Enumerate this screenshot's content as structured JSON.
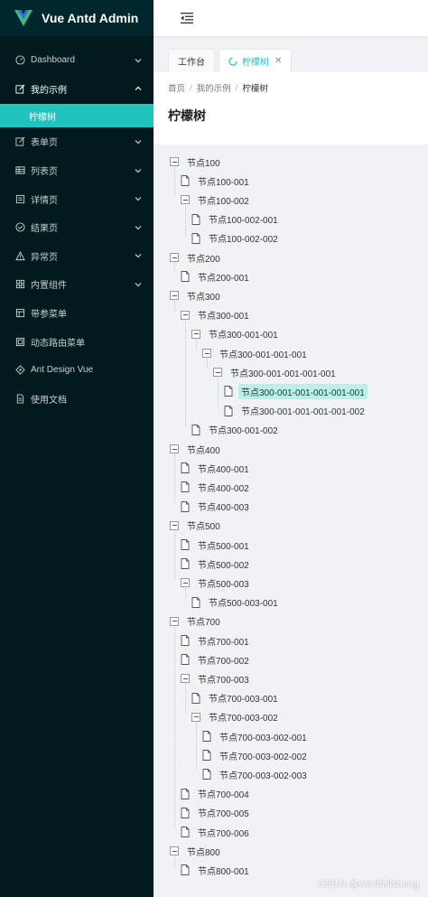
{
  "app": {
    "title": "Vue Antd Admin",
    "accent": "#20c3be",
    "sider_bg": "#001a1e"
  },
  "sidebar": {
    "items": [
      {
        "label": "Dashboard",
        "icon": "dashboard-icon",
        "has_children": true
      },
      {
        "label": "我的示例",
        "icon": "form-edit-icon",
        "has_children": true,
        "open": true
      },
      {
        "label": "表单页",
        "icon": "form-icon",
        "has_children": true
      },
      {
        "label": "列表页",
        "icon": "table-icon",
        "has_children": true
      },
      {
        "label": "详情页",
        "icon": "profile-icon",
        "has_children": true
      },
      {
        "label": "结果页",
        "icon": "check-circle-icon",
        "has_children": true
      },
      {
        "label": "异常页",
        "icon": "warning-icon",
        "has_children": true
      },
      {
        "label": "内置组件",
        "icon": "appstore-icon",
        "has_children": true
      },
      {
        "label": "带参菜单",
        "icon": "menu-icon",
        "has_children": false
      },
      {
        "label": "动态路由菜单",
        "icon": "route-icon",
        "has_children": false
      },
      {
        "label": "Ant Design Vue",
        "icon": "ant-design-icon",
        "has_children": false
      },
      {
        "label": "使用文档",
        "icon": "file-text-icon",
        "has_children": false
      }
    ],
    "active_sub": "柠檬树"
  },
  "header": {
    "fold_icon": "menu-fold-icon"
  },
  "tabs": [
    {
      "label": "工作台",
      "active": false
    },
    {
      "label": "柠檬树",
      "active": true,
      "closable": true
    }
  ],
  "breadcrumb": [
    "首页",
    "我的示例",
    "柠檬树"
  ],
  "page": {
    "title": "柠檬树"
  },
  "tree": [
    {
      "label": "节点100",
      "level": 0,
      "leaf": false
    },
    {
      "label": "节点100-001",
      "level": 1,
      "leaf": true
    },
    {
      "label": "节点100-002",
      "level": 1,
      "leaf": false
    },
    {
      "label": "节点100-002-001",
      "level": 2,
      "leaf": true
    },
    {
      "label": "节点100-002-002",
      "level": 2,
      "leaf": true
    },
    {
      "label": "节点200",
      "level": 0,
      "leaf": false
    },
    {
      "label": "节点200-001",
      "level": 1,
      "leaf": true
    },
    {
      "label": "节点300",
      "level": 0,
      "leaf": false
    },
    {
      "label": "节点300-001",
      "level": 1,
      "leaf": false
    },
    {
      "label": "节点300-001-001",
      "level": 2,
      "leaf": false
    },
    {
      "label": "节点300-001-001-001",
      "level": 3,
      "leaf": false
    },
    {
      "label": "节点300-001-001-001-001",
      "level": 4,
      "leaf": false
    },
    {
      "label": "节点300-001-001-001-001-001",
      "level": 5,
      "leaf": true,
      "selected": true
    },
    {
      "label": "节点300-001-001-001-001-002",
      "level": 5,
      "leaf": true
    },
    {
      "label": "节点300-001-002",
      "level": 2,
      "leaf": true
    },
    {
      "label": "节点400",
      "level": 0,
      "leaf": false
    },
    {
      "label": "节点400-001",
      "level": 1,
      "leaf": true
    },
    {
      "label": "节点400-002",
      "level": 1,
      "leaf": true
    },
    {
      "label": "节点400-003",
      "level": 1,
      "leaf": true
    },
    {
      "label": "节点500",
      "level": 0,
      "leaf": false
    },
    {
      "label": "节点500-001",
      "level": 1,
      "leaf": true
    },
    {
      "label": "节点500-002",
      "level": 1,
      "leaf": true
    },
    {
      "label": "节点500-003",
      "level": 1,
      "leaf": false
    },
    {
      "label": "节点500-003-001",
      "level": 2,
      "leaf": true
    },
    {
      "label": "节点700",
      "level": 0,
      "leaf": false
    },
    {
      "label": "节点700-001",
      "level": 1,
      "leaf": true
    },
    {
      "label": "节点700-002",
      "level": 1,
      "leaf": true
    },
    {
      "label": "节点700-003",
      "level": 1,
      "leaf": false
    },
    {
      "label": "节点700-003-001",
      "level": 2,
      "leaf": true
    },
    {
      "label": "节点700-003-002",
      "level": 2,
      "leaf": false
    },
    {
      "label": "节点700-003-002-001",
      "level": 3,
      "leaf": true
    },
    {
      "label": "节点700-003-002-002",
      "level": 3,
      "leaf": true
    },
    {
      "label": "节点700-003-002-003",
      "level": 3,
      "leaf": true
    },
    {
      "label": "节点700-004",
      "level": 1,
      "leaf": true
    },
    {
      "label": "节点700-005",
      "level": 1,
      "leaf": true
    },
    {
      "label": "节点700-006",
      "level": 1,
      "leaf": true
    },
    {
      "label": "节点800",
      "level": 0,
      "leaf": false
    },
    {
      "label": "节点800-001",
      "level": 1,
      "leaf": true
    }
  ],
  "watermark": "CSDN @windfallsheng"
}
